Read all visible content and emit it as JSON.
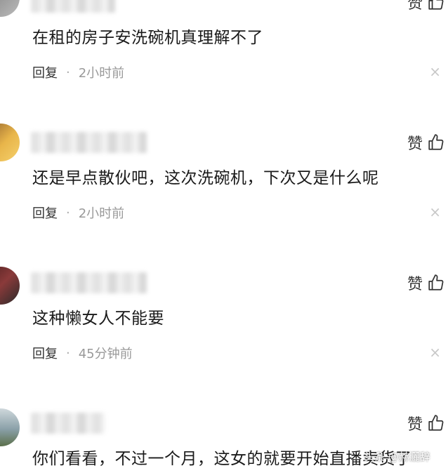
{
  "like_label": "赞",
  "reply_label": "回复",
  "close_glyph": "×",
  "separator": "·",
  "comments": [
    {
      "text": "在租的房子安洗碗机真理解不了",
      "time": "2小时前"
    },
    {
      "text": "还是早点散伙吧，这次洗碗机，下次又是什么呢",
      "time": "2小时前"
    },
    {
      "text": "这种懒女人不能要",
      "time": "45分钟前"
    },
    {
      "text": "你们看看，不过一个月，这女的就要开始直播卖货了"
    }
  ],
  "watermark": "头条 @赫灑辞"
}
